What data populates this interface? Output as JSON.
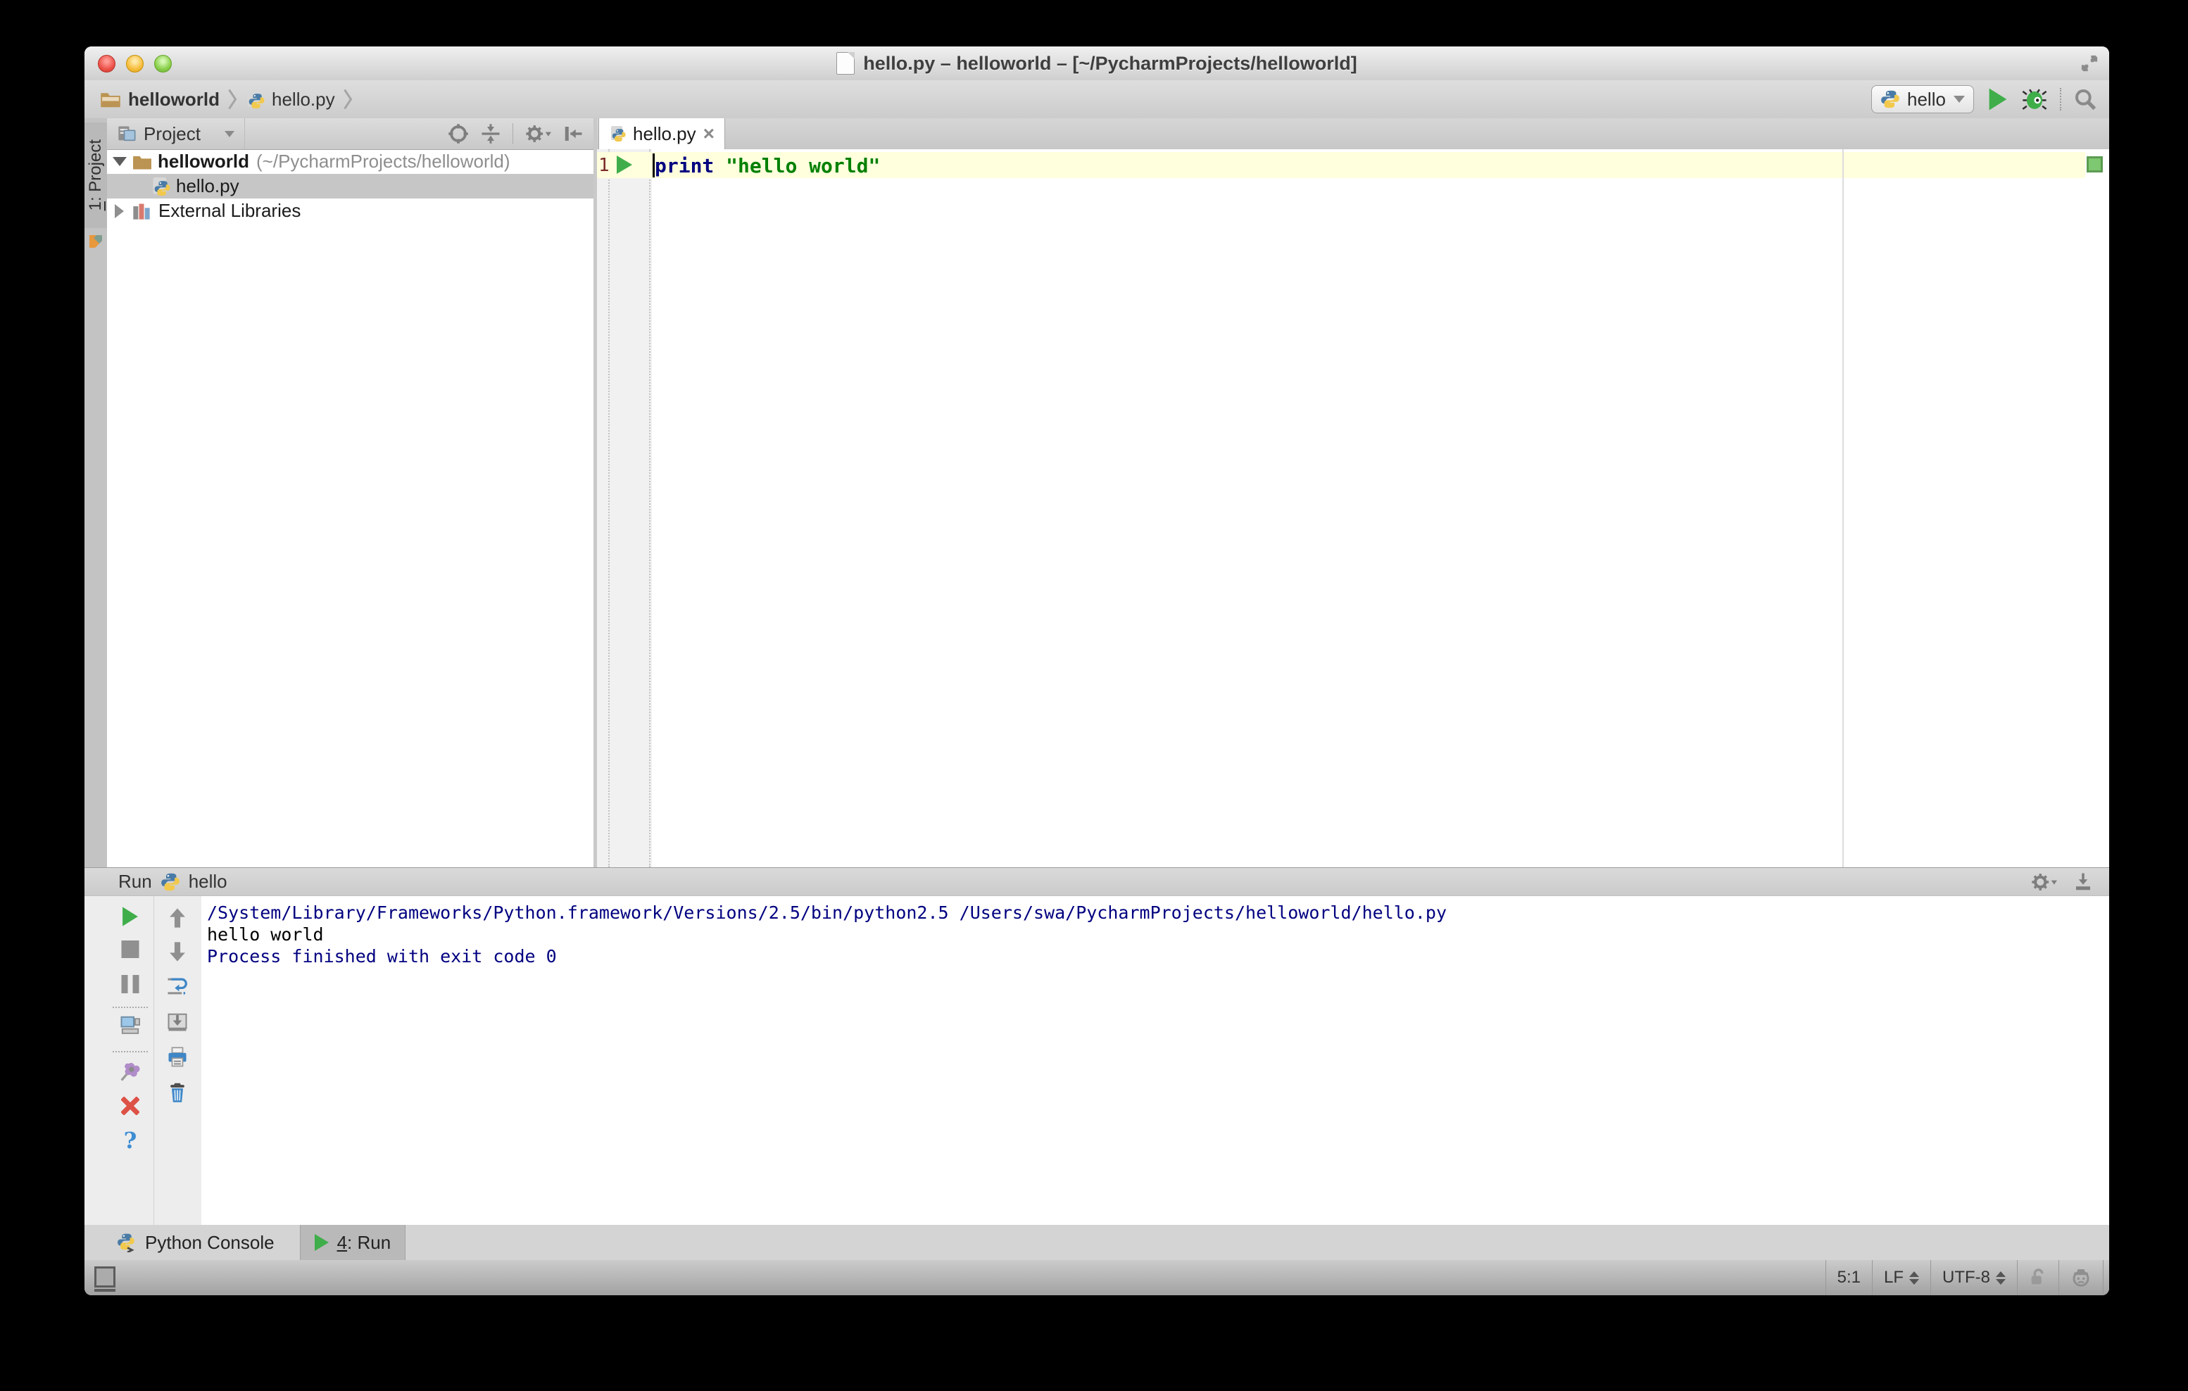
{
  "colors": {
    "accent_green": "#3fae4a",
    "keyword_color": "#000080",
    "string_color": "#008000",
    "console_info_color": "#000080",
    "current_line_bg": "#ffffdd",
    "selection_bg": "#c6c6c6"
  },
  "titlebar": {
    "title": "hello.py – helloworld – [~/PycharmProjects/helloworld]"
  },
  "toolbar": {
    "breadcrumb_project": "helloworld",
    "breadcrumb_file": "hello.py",
    "run_config": "hello"
  },
  "tool_stripe": {
    "project_tab_mnemonic": "1",
    "project_tab_rest": ": Project"
  },
  "project_panel": {
    "header_title": "Project",
    "tree": {
      "root_name": "helloworld",
      "root_path": "(~/PycharmProjects/helloworld)",
      "file": "hello.py",
      "libraries": "External Libraries"
    }
  },
  "editor": {
    "tab_label": "hello.py",
    "line_number": "1",
    "code_keyword": "print",
    "code_string": "\"hello world\""
  },
  "run_panel": {
    "title": "Run",
    "config_name": "hello",
    "console": {
      "line1": "/System/Library/Frameworks/Python.framework/Versions/2.5/bin/python2.5 /Users/swa/PycharmProjects/helloworld/hello.py",
      "line2": "hello world",
      "line3": "",
      "line4": "Process finished with exit code 0"
    }
  },
  "bottom_bar": {
    "python_console": "Python Console",
    "run_mnemonic": "4",
    "run_rest": ": Run"
  },
  "status_bar": {
    "caret_position": "5:1",
    "line_separator": "LF",
    "encoding": "UTF-8"
  }
}
